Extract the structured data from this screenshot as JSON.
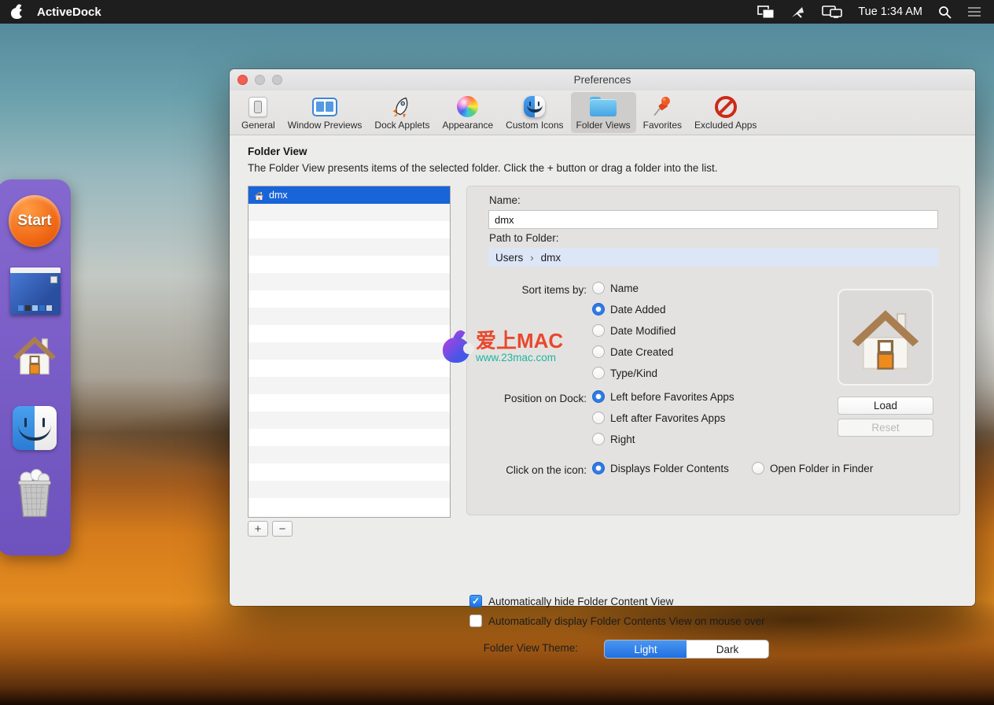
{
  "menu_bar": {
    "app_name": "ActiveDock",
    "clock": "Tue 1:34 AM"
  },
  "window": {
    "title": "Preferences"
  },
  "toolbar": {
    "tabs": [
      {
        "label": "General",
        "selected": false
      },
      {
        "label": "Window Previews",
        "selected": false
      },
      {
        "label": "Dock Applets",
        "selected": false
      },
      {
        "label": "Appearance",
        "selected": false
      },
      {
        "label": "Custom Icons",
        "selected": false
      },
      {
        "label": "Folder Views",
        "selected": true
      },
      {
        "label": "Favorites",
        "selected": false
      },
      {
        "label": "Excluded Apps",
        "selected": false
      }
    ]
  },
  "content": {
    "heading": "Folder View",
    "description": "The Folder View presents items of the selected folder. Click the + button or drag a folder into the list.",
    "list": {
      "items": [
        {
          "name": "dmx",
          "selected": true
        }
      ],
      "add_label": "+",
      "remove_label": "−"
    },
    "detail": {
      "name_label": "Name:",
      "name_value": "dmx",
      "path_label": "Path to Folder:",
      "path_segments": [
        "Users",
        "dmx"
      ],
      "path_separator": "›",
      "sort": {
        "label": "Sort items by:",
        "options": [
          "Name",
          "Date Added",
          "Date Modified",
          "Date Created",
          "Type/Kind"
        ],
        "selected": "Date Added"
      },
      "position": {
        "label": "Position on Dock:",
        "options": [
          "Left before Favorites Apps",
          "Left after Favorites Apps",
          "Right"
        ],
        "selected": "Left before Favorites Apps"
      },
      "click": {
        "label": "Click on the icon:",
        "options": [
          "Displays Folder Contents",
          "Open Folder in Finder"
        ],
        "selected": "Displays Folder Contents"
      },
      "load_label": "Load",
      "reset_label": "Reset",
      "reset_enabled": false
    },
    "checkboxes": [
      {
        "label": "Automatically hide Folder Content View",
        "checked": true
      },
      {
        "label": "Automatically display Folder Contents View on mouse over",
        "checked": false
      }
    ],
    "theme": {
      "label": "Folder View Theme:",
      "segments": [
        "Light",
        "Dark"
      ],
      "selected": "Light"
    }
  },
  "dock": {
    "start_label": "Start"
  },
  "watermark": {
    "title": "爱上MAC",
    "url": "www.23mac.com"
  },
  "colors": {
    "accent": "#2070e1",
    "selection_blue": "#1864d9",
    "path_bar_blue": "#dde6f6",
    "dock_purple": "#7a5ec5",
    "start_orange": "#ef6512",
    "menubar_dark": "#1e1e1e"
  }
}
